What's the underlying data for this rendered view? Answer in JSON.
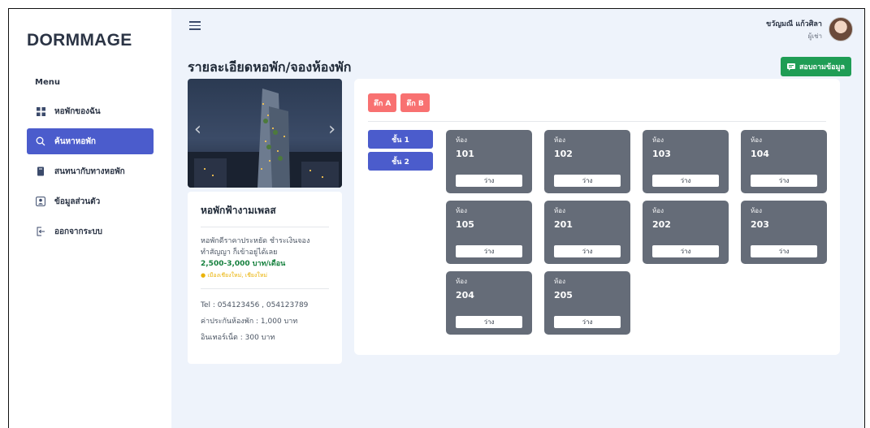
{
  "app": {
    "logo": "DORMMAGE"
  },
  "sidebar": {
    "menu_title": "Menu",
    "items": [
      {
        "label": "หอพักของฉัน",
        "icon": "grid-icon",
        "active": false
      },
      {
        "label": "ค้นหาหอพัก",
        "icon": "search-icon",
        "active": true
      },
      {
        "label": "สนทนากับทางหอพัก",
        "icon": "book-icon",
        "active": false
      },
      {
        "label": "ข้อมูลส่วนตัว",
        "icon": "user-icon",
        "active": false
      },
      {
        "label": "ออกจากระบบ",
        "icon": "logout-icon",
        "active": false
      }
    ]
  },
  "header": {
    "user_name": "ขวัญมณี แก้วศิลา",
    "user_role": "ผู้เช่า"
  },
  "page": {
    "title": "รายละเอียดหอพัก/จองห้องพัก",
    "contact_button": "สอบถามข้อมูล"
  },
  "dorm": {
    "name": "หอพักฟ้างามเพลส",
    "desc_line1": "หอพักดีราคาประหยัด ชำระเงินจอง",
    "desc_line2": "ทำสัญญา ก็เข้าอยู่ได้เลย",
    "price": "2,500-3,000 บาท/เดือน",
    "location": "เมืองเชียงใหม่, เชียงใหม่",
    "tel": "Tel : 054123456 , 054123789",
    "deposit": "ค่าประกันห้องพัก : 1,000 บาท",
    "internet": "อินเทอร์เน็ต : 300 บาท"
  },
  "buildings": [
    "ตึก A",
    "ตึก B"
  ],
  "floors": [
    "ชั้น 1",
    "ชั้น 2"
  ],
  "room_label": "ห้อง",
  "rooms": [
    {
      "number": "101",
      "status": "ว่าง"
    },
    {
      "number": "102",
      "status": "ว่าง"
    },
    {
      "number": "103",
      "status": "ว่าง"
    },
    {
      "number": "104",
      "status": "ว่าง"
    },
    {
      "number": "105",
      "status": "ว่าง"
    },
    {
      "number": "201",
      "status": "ว่าง"
    },
    {
      "number": "202",
      "status": "ว่าง"
    },
    {
      "number": "203",
      "status": "ว่าง"
    },
    {
      "number": "204",
      "status": "ว่าง"
    },
    {
      "number": "205",
      "status": "ว่าง"
    }
  ],
  "colors": {
    "accent": "#4b5ccc",
    "building_tab": "#f87171",
    "contact": "#1f9d55",
    "room_card": "#656c78",
    "price": "#15803d"
  }
}
